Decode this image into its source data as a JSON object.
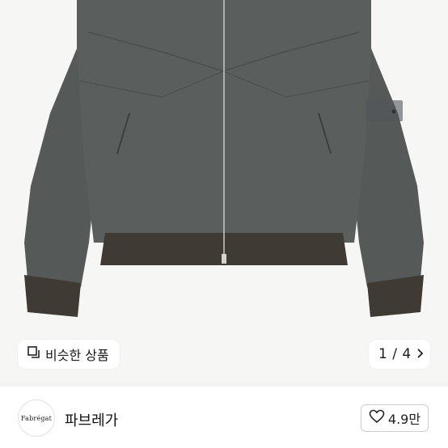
{
  "gallery": {
    "photo_alt": "charcoal gray bomber jacket",
    "similar_label": "비슷한 상품",
    "counter": "1 / 4"
  },
  "seller": {
    "logo_text": "Fabrégat",
    "name": "파브레가",
    "like_count": "4.9만"
  },
  "colors": {
    "jacket": "#595e5c",
    "rib": "#3f3a33",
    "background": "#f6f6f4"
  },
  "icons": {
    "similar": "similar-items-icon",
    "next": "chevron-right-icon",
    "like": "heart-outline-icon"
  }
}
